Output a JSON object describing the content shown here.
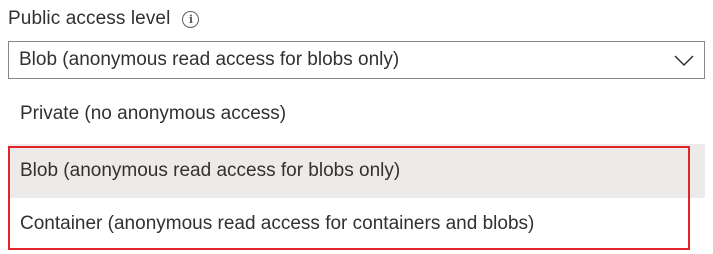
{
  "field": {
    "label": "Public access level",
    "info_icon": "info-icon"
  },
  "dropdown": {
    "selected_value": "Blob (anonymous read access for blobs only)",
    "chevron_icon": "chevron-down-icon",
    "options": [
      {
        "label": "Private (no anonymous access)"
      },
      {
        "label": "Blob (anonymous read access for blobs only)",
        "hovered": true
      },
      {
        "label": "Container (anonymous read access for containers and blobs)"
      }
    ]
  },
  "annotation": {
    "highlight_color": "#e3242b"
  },
  "colors": {
    "text": "#323130",
    "border": "#8a8886",
    "hover_background": "#edebe9"
  }
}
